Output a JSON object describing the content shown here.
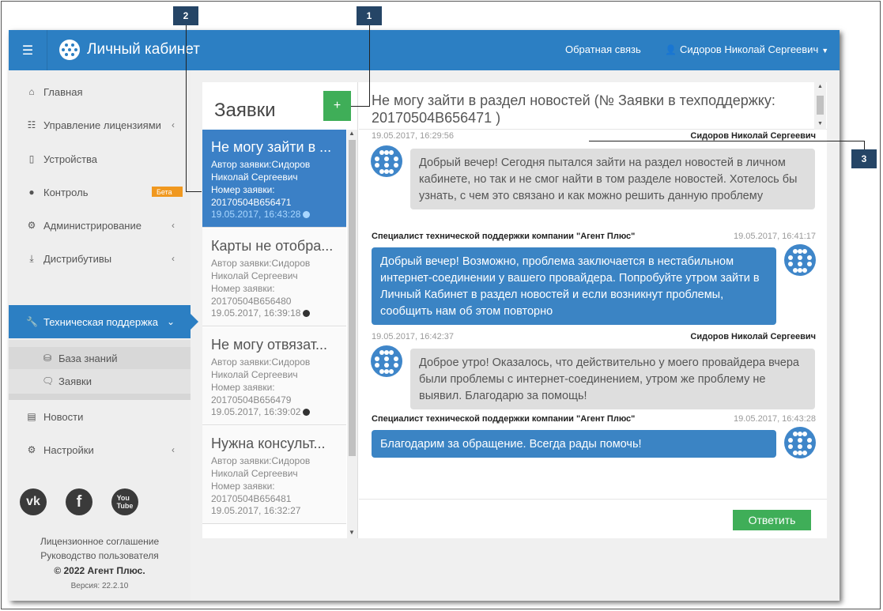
{
  "header": {
    "title": "Личный кабинет",
    "feedback": "Обратная связь",
    "user": "Сидоров Николай Сергеевич"
  },
  "sidebar": {
    "items": [
      {
        "label": "Главная",
        "icon": "home-icon"
      },
      {
        "label": "Управление лицензиями",
        "icon": "sitemap-icon"
      },
      {
        "label": "Устройства",
        "icon": "mobile-icon"
      },
      {
        "label": "Контроль",
        "icon": "globe-icon",
        "badge": "Бета"
      },
      {
        "label": "Администрирование",
        "icon": "cogs-icon"
      },
      {
        "label": "Дистрибутивы",
        "icon": "download-icon"
      },
      {
        "label": "Техническая поддержка",
        "icon": "wrench-icon"
      },
      {
        "label": "Новости",
        "icon": "newspaper-icon"
      },
      {
        "label": "Настройки",
        "icon": "gear-icon"
      }
    ],
    "subitems": [
      {
        "label": "База знаний",
        "icon": "database-icon"
      },
      {
        "label": "Заявки",
        "icon": "comments-icon"
      }
    ],
    "footer": {
      "license": "Лицензионное соглашение",
      "guide": "Руководство пользователя",
      "copyright": "© 2022 Агент Плюс.",
      "version": "Версия: 22.2.10"
    }
  },
  "tickets": {
    "title": "Заявки",
    "add_label": "+",
    "items": [
      {
        "title": "Не могу зайти в ...",
        "author": "Автор заявки:Сидоров Николай Сергеевич",
        "number": "Номер заявки: 20170504B656471",
        "date": "19.05.2017, 16:43:28",
        "dot": true
      },
      {
        "title": "Карты не отобра...",
        "author": "Автор заявки:Сидоров Николай Сергеевич",
        "number": "Номер заявки: 20170504B656480",
        "date": "19.05.2017, 16:39:18",
        "dot": true
      },
      {
        "title": "Не могу отвязат...",
        "author": "Автор заявки:Сидоров Николай Сергеевич",
        "number": "Номер заявки: 20170504B656479",
        "date": "19.05.2017, 16:39:02",
        "dot": true
      },
      {
        "title": "Нужна консульт...",
        "author": "Автор заявки:Сидоров Николай Сергеевич",
        "number": "Номер заявки: 20170504B656481",
        "date": "19.05.2017, 16:32:27",
        "dot": false
      }
    ]
  },
  "chat": {
    "title": "Не могу зайти в раздел новостей (№ Заявки в техподдержку: 20170504B656471 )",
    "messages": [
      {
        "side": "user",
        "author": "Сидоров Николай Сергеевич",
        "time": "19.05.2017, 16:29:56",
        "text": "Добрый вечер! Сегодня пытался зайти на раздел новостей в личном кабинете, но так и не смог найти в том разделе новостей. Хотелось бы узнать, с чем это связано и как можно решить данную проблему"
      },
      {
        "side": "support",
        "author": "Специалист технической поддержки компании \"Агент Плюс\"",
        "time": "19.05.2017, 16:41:17",
        "text": "Добрый вечер! Возможно, проблема заключается в нестабильном интернет-соединении у вашего провайдера. Попробуйте утром зайти в Личный Кабинет в раздел новостей и если возникнут проблемы, сообщить нам об этом повторно"
      },
      {
        "side": "user",
        "author": "Сидоров Николай Сергеевич",
        "time": "19.05.2017, 16:42:37",
        "text": "Доброе утро! Оказалось, что действительно у моего провайдера вчера были проблемы с интернет-соединением, утром же проблему не выявил. Благодарю за помощь!"
      },
      {
        "side": "support",
        "author": "Специалист технической поддержки компании \"Агент Плюс\"",
        "time": "19.05.2017, 16:43:28",
        "text": "Благодарим за обращение. Всегда рады помочь!"
      }
    ],
    "reply_label": "Ответить"
  },
  "callouts": [
    "1",
    "2",
    "3"
  ],
  "colors": {
    "primary": "#2c7fc3",
    "success": "#3fae58",
    "badge": "#f0981f",
    "callout": "#254566"
  }
}
